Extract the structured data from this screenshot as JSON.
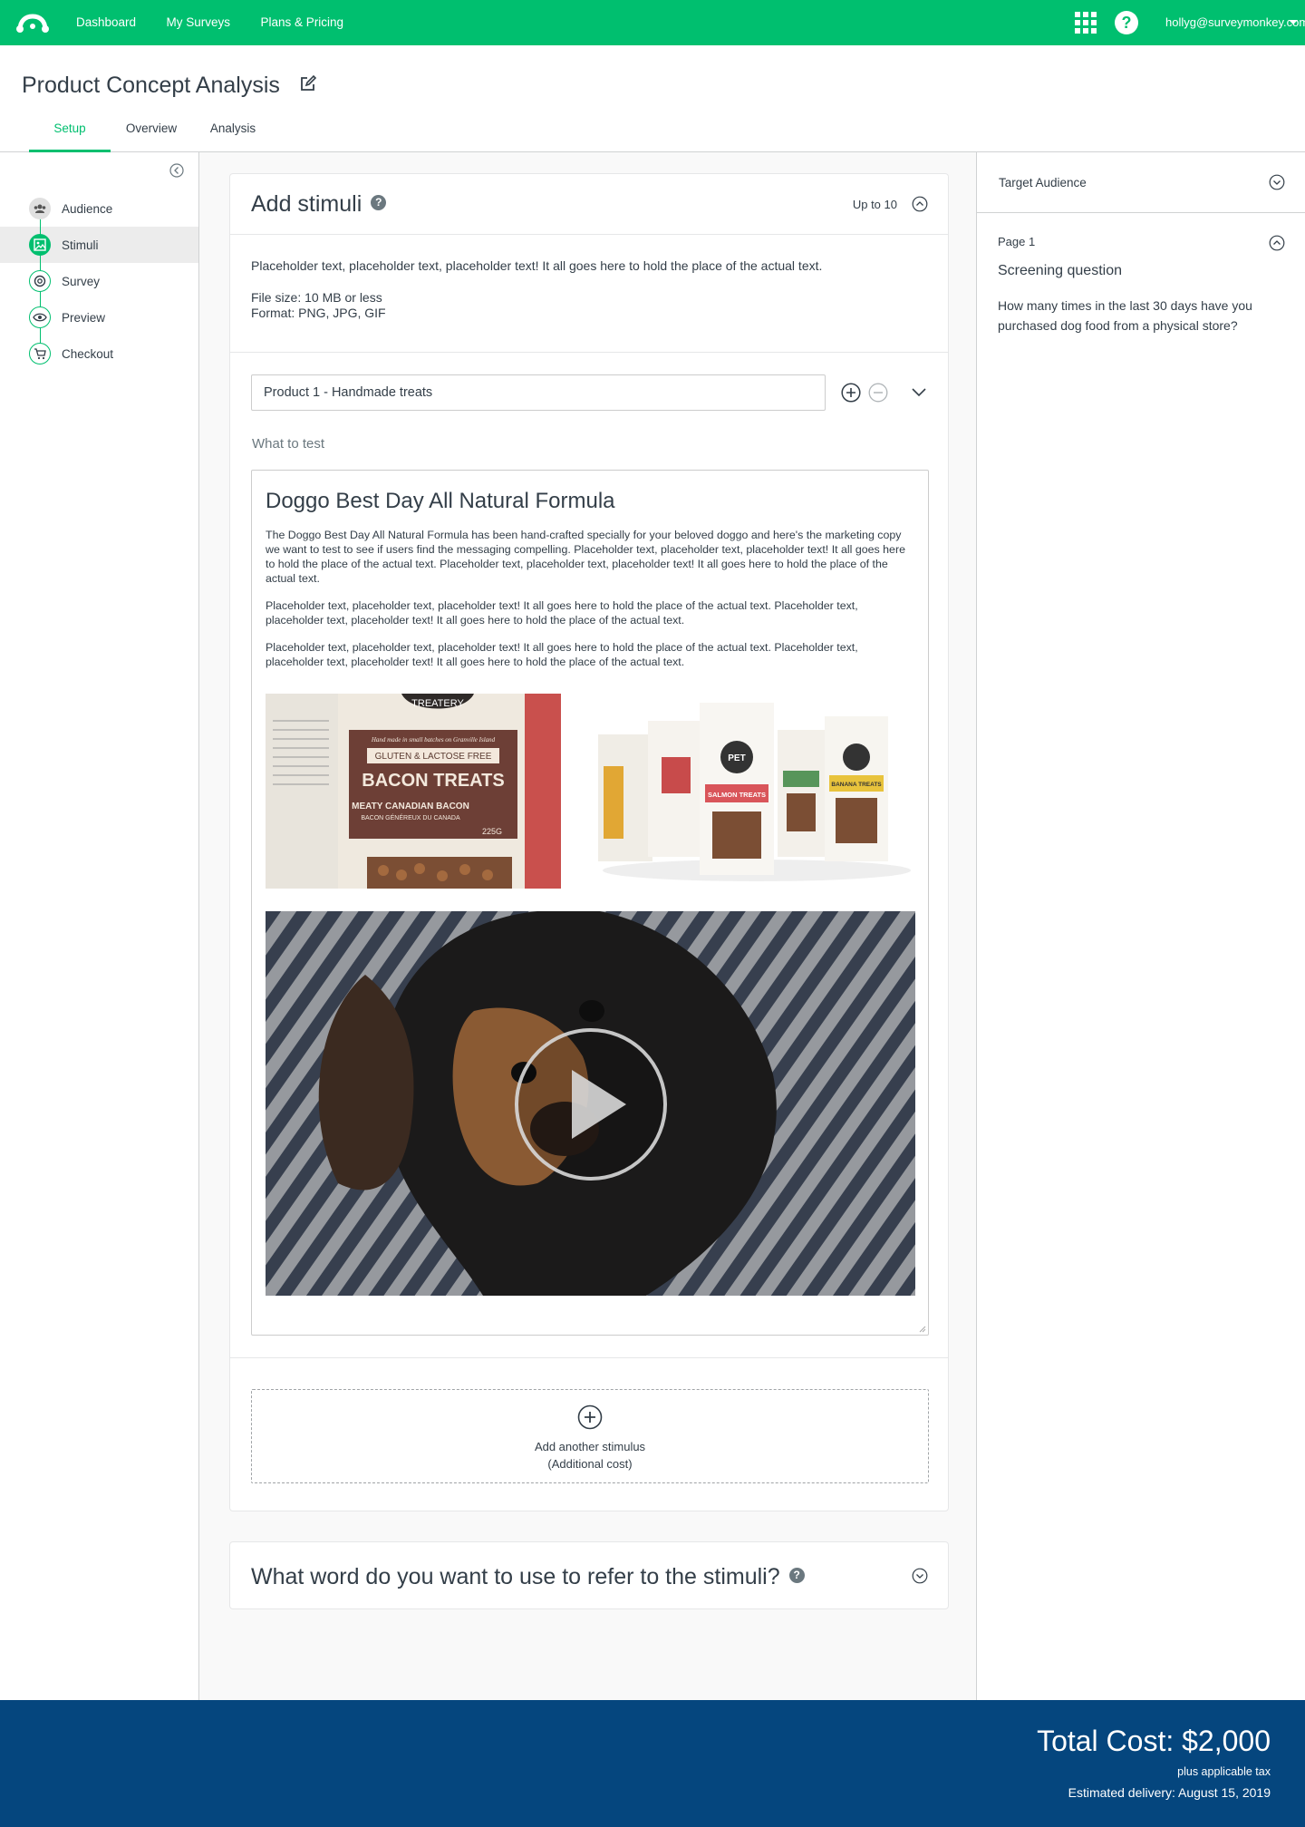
{
  "topbar": {
    "logo_icon": "surveymonkey-logo-icon",
    "nav": [
      "Dashboard",
      "My Surveys",
      "Plans & Pricing"
    ],
    "apps_icon": "apps-grid-icon",
    "help_icon": "help-icon",
    "user_email": "hollyg@surveymonkey.com"
  },
  "header": {
    "title": "Product Concept Analysis",
    "tabs": [
      "Setup",
      "Overview",
      "Analysis"
    ],
    "active_tab": "Setup"
  },
  "sidebar": {
    "items": [
      {
        "label": "Audience",
        "icon": "audience-icon"
      },
      {
        "label": "Stimuli",
        "icon": "image-icon",
        "active": true
      },
      {
        "label": "Survey",
        "icon": "survey-icon"
      },
      {
        "label": "Preview",
        "icon": "eye-icon"
      },
      {
        "label": "Checkout",
        "icon": "cart-icon"
      }
    ]
  },
  "stimuli": {
    "title": "Add stimuli",
    "limit": "Up to 10",
    "description": "Placeholder text, placeholder text, placeholder text! It all goes here to hold the place of the actual text.",
    "file_size": "File size: 10 MB or less",
    "format": "Format: PNG, JPG, GIF",
    "product_name": "Product 1 - Handmade treats",
    "what_to_test_label": "What to test",
    "editor": {
      "heading": "Doggo Best Day All Natural Formula",
      "paragraphs": [
        "The Doggo Best Day All Natural Formula has been hand-crafted specially for your beloved doggo and here's the marketing copy we want to test to see if users find the messaging compelling. Placeholder text, placeholder text, placeholder text! It all goes here to hold the place of the actual text. Placeholder text, placeholder text, placeholder text! It all goes here to hold the place of the actual text.",
        "Placeholder text, placeholder text, placeholder text! It all goes here to hold the place of the actual text. Placeholder text, placeholder text, placeholder text! It all goes here to hold the place of the actual text.",
        "Placeholder text, placeholder text, placeholder text! It all goes here to hold the place of the actual text. Placeholder text, placeholder text, placeholder text! It all goes here to hold the place of the actual text."
      ],
      "image1_text": {
        "top": "TREATERY",
        "line1": "Hand made in small batches on Granville Island",
        "line2": "GLUTEN & LACTOSE FREE",
        "line3": "BACON TREATS",
        "line4": "MEATY CANADIAN BACON",
        "line5": "BACON GÉNÉREUX DU CANADA",
        "line6": "225G"
      },
      "image2_text": {
        "brand": "PET",
        "center": "SALMON TREATS",
        "right": "BANANA TREATS"
      }
    },
    "add_another": {
      "line1": "Add another stimulus",
      "line2": "(Additional cost)"
    }
  },
  "stimuli_word": {
    "title": "What word do you want to use to refer to the stimuli?"
  },
  "right_panel": {
    "section": "Target Audience",
    "page_label": "Page 1",
    "question_title": "Screening question",
    "question_text": "How many times in the last 30 days have you purchased dog food from a physical store?"
  },
  "footer": {
    "total": "Total Cost: $2,000",
    "tax": "plus applicable tax",
    "delivery": "Estimated delivery: August 15, 2019"
  },
  "colors": {
    "brand_green": "#00bf6f",
    "footer_blue": "#05467e",
    "text": "#333e48"
  }
}
